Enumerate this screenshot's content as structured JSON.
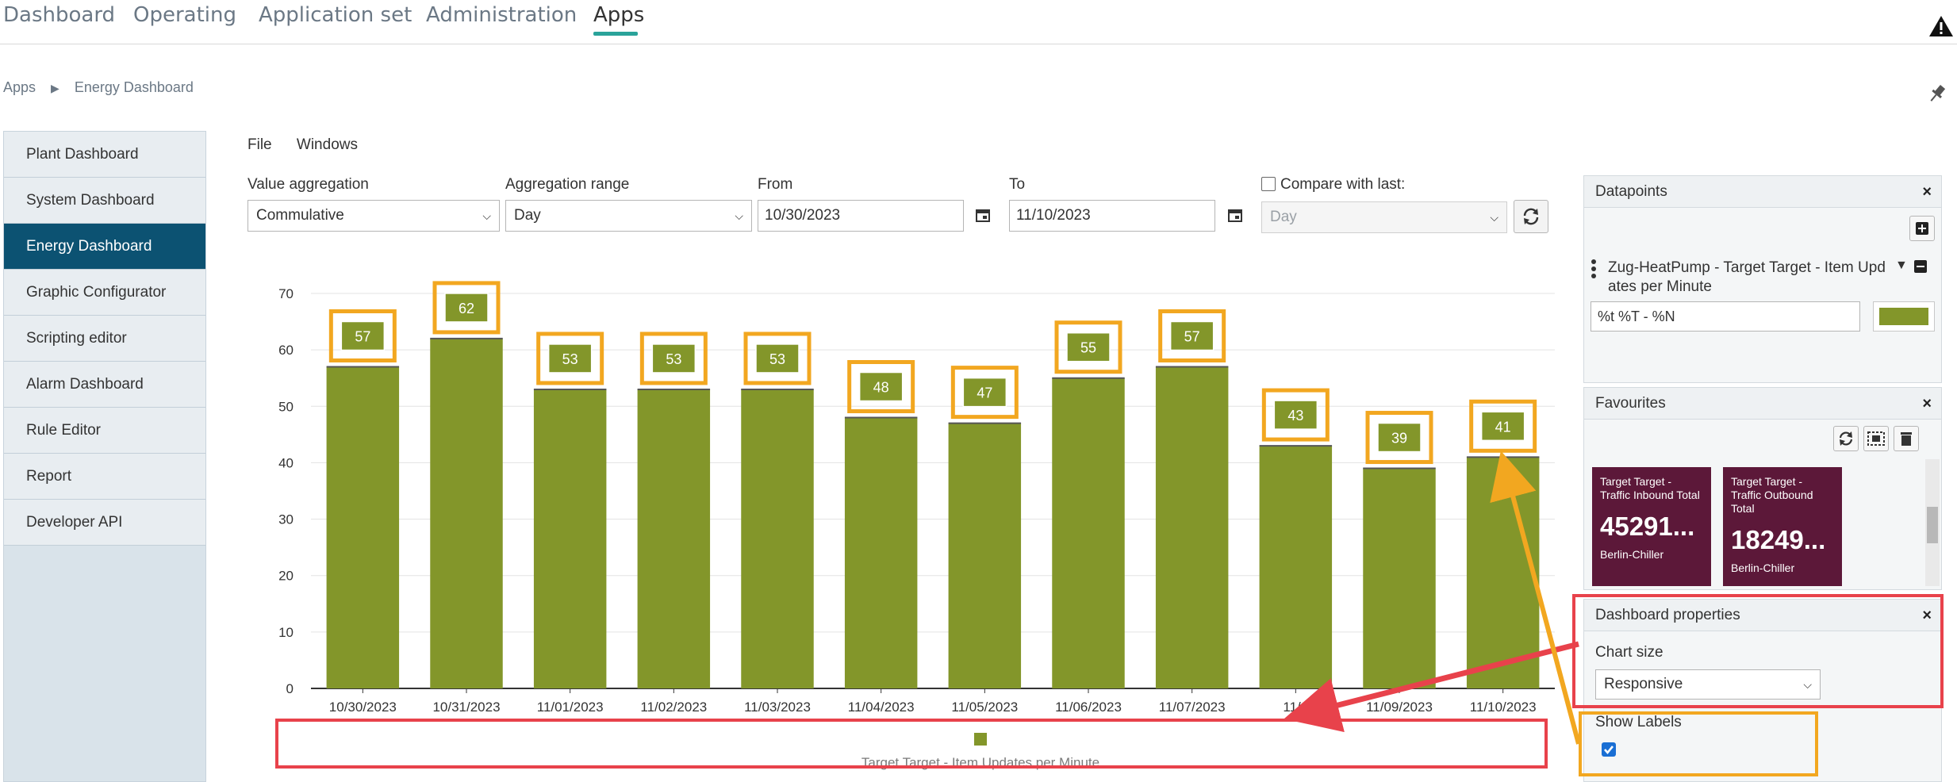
{
  "topnav": {
    "tabs": [
      "Dashboard",
      "Operating",
      "Application set",
      "Administration",
      "Apps"
    ],
    "active": "Apps"
  },
  "breadcrumb": [
    "Apps",
    "Energy Dashboard"
  ],
  "sidebar": {
    "items": [
      {
        "label": "Plant Dashboard"
      },
      {
        "label": "System Dashboard"
      },
      {
        "label": "Energy Dashboard"
      },
      {
        "label": "Graphic Configurator"
      },
      {
        "label": "Scripting editor"
      },
      {
        "label": "Alarm Dashboard"
      },
      {
        "label": "Rule Editor"
      },
      {
        "label": "Report"
      },
      {
        "label": "Developer API"
      }
    ],
    "active_index": 2
  },
  "menu": {
    "file": "File",
    "windows": "Windows"
  },
  "filters": {
    "value_aggregation_label": "Value aggregation",
    "value_aggregation": "Commulative",
    "aggregation_range_label": "Aggregation range",
    "aggregation_range": "Day",
    "from_label": "From",
    "from": "10/30/2023",
    "to_label": "To",
    "to": "11/10/2023",
    "compare_label": "Compare with last:",
    "compare_checked": false,
    "compare_value": "Day"
  },
  "chart_data": {
    "type": "bar",
    "categories": [
      "10/30/2023",
      "10/31/2023",
      "11/01/2023",
      "11/02/2023",
      "11/03/2023",
      "11/04/2023",
      "11/05/2023",
      "11/06/2023",
      "11/07/2023",
      "11/08/2023",
      "11/09/2023",
      "11/10/2023"
    ],
    "category_labels_shown": [
      "10/30/2023",
      "10/31/2023",
      "11/01/2023",
      "11/02/2023",
      "11/03/2023",
      "11/04/2023",
      "11/05/2023",
      "11/06/2023",
      "11/07/2023",
      "11/0",
      "11/09/2023",
      "11/10/2023"
    ],
    "series": [
      {
        "name": "Target Target - Item Updates per Minute",
        "values": [
          57,
          62,
          53,
          53,
          53,
          48,
          47,
          55,
          57,
          43,
          39,
          41
        ]
      }
    ],
    "data_labels": [
      "57",
      "62",
      "53",
      "53",
      "53",
      "48",
      "47",
      "55",
      "57",
      "43",
      "39",
      "41"
    ],
    "yticks": [
      "0",
      "10",
      "20",
      "30",
      "40",
      "50",
      "60",
      "70"
    ],
    "ylim": [
      0,
      70
    ],
    "grid": true,
    "legend_placement": "bottom",
    "color": "#83962a"
  },
  "datapoints": {
    "title": "Datapoints",
    "item": "Zug-HeatPump - Target Target - Item Upd",
    "item_wrap": "ates per Minute",
    "format": "%t %T - %N",
    "color": "#83962a"
  },
  "favourites": {
    "title": "Favourites",
    "tiles": [
      {
        "title": "Target Target - Traffic Inbound Total",
        "value": "45291...",
        "site": "Berlin-Chiller"
      },
      {
        "title": "Target Target - Traffic Outbound Total",
        "value": "18249...",
        "site": "Berlin-Chiller"
      }
    ]
  },
  "dashboard_props": {
    "title": "Dashboard properties",
    "chart_size_label": "Chart size",
    "chart_size": "Responsive",
    "show_labels_label": "Show Labels",
    "show_labels_checked": true
  },
  "colors": {
    "accent": "#2aa39a",
    "sidebar_active": "#0c5272",
    "bar": "#83962a",
    "tile": "#5c1839",
    "annotation_red": "#e8424b",
    "annotation_orange": "#f2a720"
  }
}
